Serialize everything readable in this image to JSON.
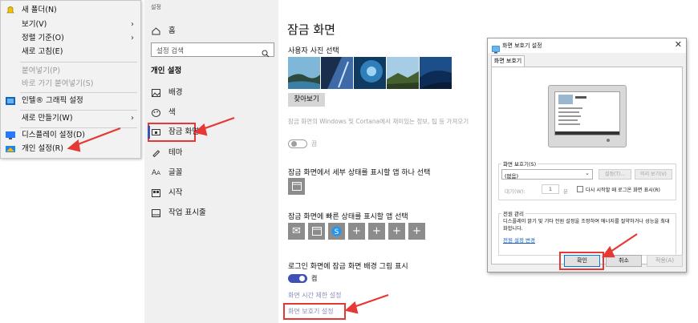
{
  "context_menu": {
    "items": [
      {
        "label": "새 폴더(N)",
        "disabled": false,
        "submenu": false
      },
      {
        "label": "보기(V)",
        "disabled": false,
        "submenu": true
      },
      {
        "label": "정렬 기준(O)",
        "disabled": false,
        "submenu": true
      },
      {
        "label": "새로 고침(E)",
        "disabled": false,
        "submenu": false
      },
      {
        "label": "붙여넣기(P)",
        "disabled": true,
        "submenu": false
      },
      {
        "label": "바로 가기 붙여넣기(S)",
        "disabled": true,
        "submenu": false
      },
      {
        "label": "인텔® 그래픽 설정",
        "disabled": false,
        "submenu": false
      },
      {
        "label": "새로 만들기(W)",
        "disabled": false,
        "submenu": true
      },
      {
        "label": "디스플레이 설정(D)",
        "disabled": false,
        "submenu": false
      },
      {
        "label": "개인 설정(R)",
        "disabled": false,
        "submenu": false
      }
    ]
  },
  "settings": {
    "window_title": "설정",
    "home_label": "홈",
    "search_placeholder": "설정 검색",
    "section_title": "개인 설정",
    "nav": [
      {
        "label": "배경",
        "icon": "image-icon"
      },
      {
        "label": "색",
        "icon": "palette-icon"
      },
      {
        "label": "잠금 화면",
        "icon": "lock-screen-icon",
        "active": true
      },
      {
        "label": "테마",
        "icon": "brush-icon"
      },
      {
        "label": "글꼴",
        "icon": "font-icon"
      },
      {
        "label": "시작",
        "icon": "start-icon"
      },
      {
        "label": "작업 표시줄",
        "icon": "taskbar-icon"
      }
    ]
  },
  "lock_screen": {
    "title": "잠금 화면",
    "picture_heading": "사용자 사진 선택",
    "browse_label": "찾아보기",
    "fun_facts_text": "잠금 화면의 Windows 및 Cortana에서 재미있는 정보, 팁 등 가져오기",
    "fun_facts_state": "끔",
    "detailed_heading": "잠금 화면에서 세부 상태를 표시할 앱 하나 선택",
    "quick_heading": "잠금 화면에 빠른 상태를 표시할 앱 선택",
    "signin_bg_heading": "로그인 화면에 잠금 화면 배경 그림 표시",
    "signin_bg_state": "켬",
    "timeout_link": "화면 시간 제한 설정",
    "screensaver_link": "화면 보호기 설정"
  },
  "dialog": {
    "title": "화면 보호기 설정",
    "tab_label": "화면 보호기",
    "group_label": "화면 보호기(S)",
    "dropdown_value": "(없음)",
    "settings_button": "설정(T)...",
    "preview_button": "미리 보기(V)",
    "wait_label": "대기(W):",
    "wait_value": "1",
    "minutes_label": "분",
    "resume_label": "다시 시작할 때 로그온 화면 표시(R)",
    "power_group_label": "전원 관리",
    "power_text": "디스플레이 밝기 및 기타 전원 설정을 조정하여 에너지를 절약하거나 성능을 최대화합니다.",
    "power_link": "전원 설정 변경",
    "ok_label": "확인",
    "cancel_label": "취소",
    "apply_label": "적용(A)"
  },
  "colors": {
    "accent": "#3f51b5",
    "highlight_red": "#e53935",
    "link": "#1a5fb4"
  }
}
